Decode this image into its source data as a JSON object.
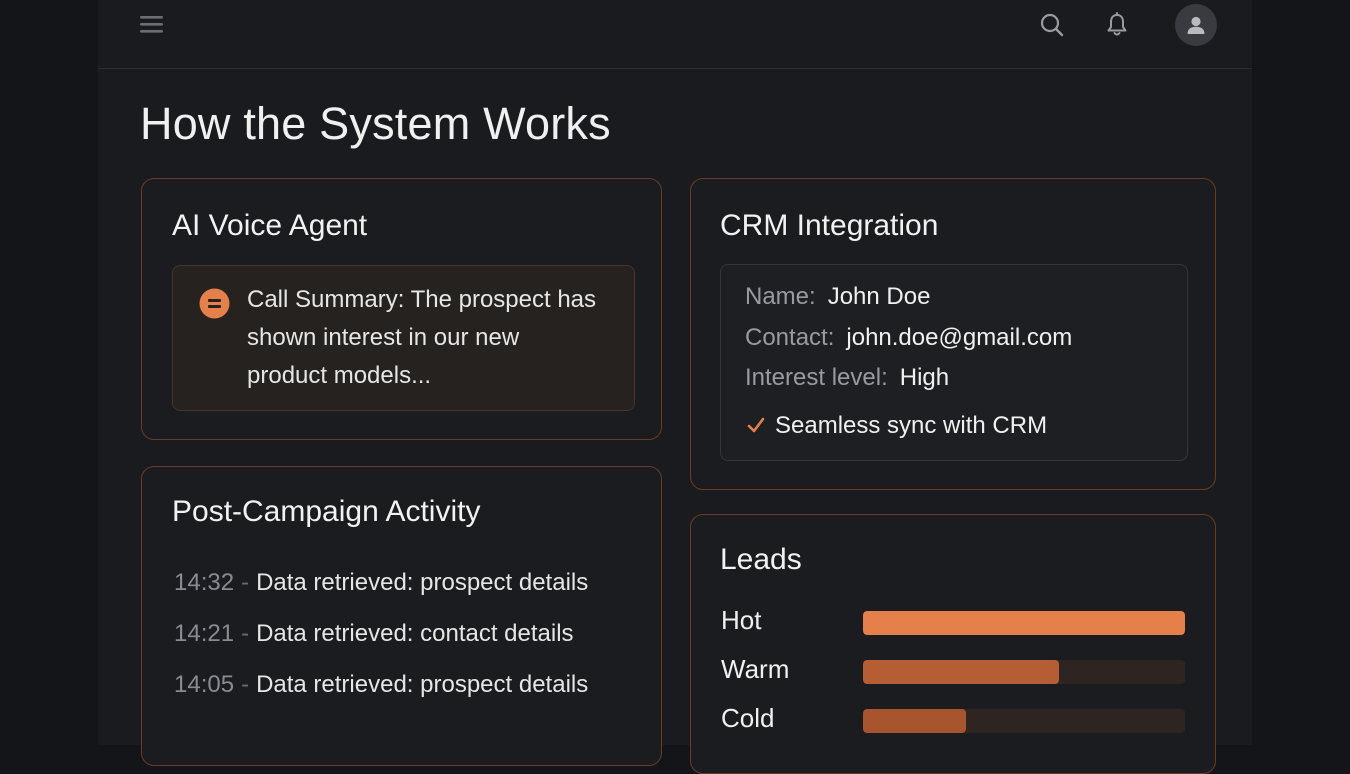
{
  "header": {
    "menu_icon": "hamburger-menu-icon",
    "search_icon": "search-icon",
    "notifications_icon": "bell-icon",
    "avatar_icon": "user-avatar-icon"
  },
  "page": {
    "title": "How the System Works"
  },
  "voice_agent": {
    "title": "AI Voice Agent",
    "summary_icon": "summary-icon",
    "summary": "Call Summary: The prospect has shown interest in our new product models..."
  },
  "activity": {
    "title": "Post-Campaign Activity",
    "separator": "-",
    "items": [
      {
        "time": "14:32",
        "text": "Data retrieved: prospect details"
      },
      {
        "time": "14:21",
        "text": "Data retrieved: contact details"
      },
      {
        "time": "14:05",
        "text": "Data retrieved: prospect details"
      }
    ]
  },
  "crm": {
    "title": "CRM Integration",
    "name_label": "Name:",
    "name_value": "John Doe",
    "contact_label": "Contact:",
    "contact_value": "john.doe@gmail.com",
    "interest_label": "Interest level:",
    "interest_value": "High",
    "sync_icon": "checkmark-icon",
    "sync_text": "Seamless sync with CRM"
  },
  "leads": {
    "title": "Leads",
    "items": [
      {
        "label": "Hot",
        "level": 1.0,
        "color": "#e5804a"
      },
      {
        "label": "Warm",
        "level": 0.61,
        "color": "#b55e33"
      },
      {
        "label": "Cold",
        "level": 0.32,
        "color": "#a8552f"
      }
    ]
  },
  "colors": {
    "accent": "#e5804a",
    "background": "#141518",
    "card_border": "#6a3c22"
  }
}
